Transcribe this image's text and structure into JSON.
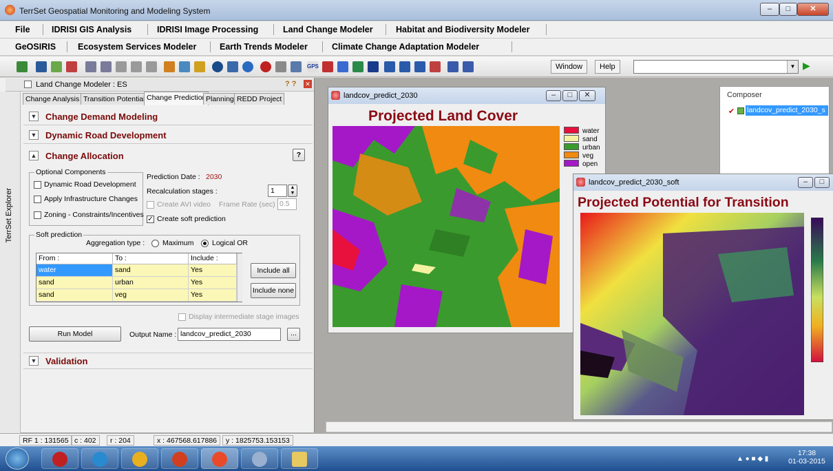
{
  "window": {
    "title": "TerrSet Geospatial Monitoring and Modeling System",
    "min": "–",
    "max": "□",
    "close": "✕"
  },
  "menu1": [
    "File",
    "IDRISI GIS Analysis",
    "IDRISI Image Processing",
    "Land Change Modeler",
    "Habitat and Biodiversity Modeler"
  ],
  "menu2": [
    "GeOSIRIS",
    "Ecosystem Services Modeler",
    "Earth Trends Modeler",
    "Climate Change Adaptation Modeler"
  ],
  "toolbar": {
    "window": "Window",
    "help": "Help",
    "gps": "GPS",
    "run": "▶"
  },
  "explorer": {
    "label": "TerrSet Explorer",
    "expand": "+"
  },
  "lcm": {
    "title": "Land Change Modeler : ES",
    "help_icons": "? ?",
    "tabs": [
      "Change Analysis",
      "Transition Potentials",
      "Change Prediction",
      "Planning",
      "REDD Project"
    ],
    "sections": {
      "demand": "Change Demand Modeling",
      "road": "Dynamic Road Development",
      "allocation": "Change Allocation",
      "validation": "Validation"
    },
    "help_btn": "?",
    "optional_components": "Optional Components",
    "opt": [
      "Dynamic Road Development",
      "Apply Infrastructure Changes",
      "Zoning - Constraints/Incentives"
    ],
    "prediction_date_label": "Prediction Date :",
    "prediction_date": "2030",
    "recalc_label": "Recalculation stages :",
    "recalc_value": "1",
    "avi_label": "Create AVI video",
    "frame_rate_label": "Frame Rate (sec) :",
    "frame_rate": "0.5",
    "soft_label": "Create soft prediction",
    "soft_prediction": "Soft prediction",
    "aggregation_label": "Aggregation type :",
    "agg_max": "Maximum",
    "agg_or": "Logical OR",
    "grid_headers": [
      "From :",
      "To :",
      "Include :"
    ],
    "grid_rows": [
      [
        "water",
        "sand",
        "Yes"
      ],
      [
        "sand",
        "urban",
        "Yes"
      ],
      [
        "sand",
        "veg",
        "Yes"
      ]
    ],
    "include_all": "Include all",
    "include_none": "Include none",
    "display_intermediate": "Display intermediate stage images",
    "run_model": "Run Model",
    "output_label": "Output Name :",
    "output_value": "landcov_predict_2030",
    "browse": "..."
  },
  "map1": {
    "title": "landcov_predict_2030",
    "heading": "Projected Land Cover",
    "legend": [
      {
        "label": "water",
        "color": "#e8103c"
      },
      {
        "label": "sand",
        "color": "#f4f2a0"
      },
      {
        "label": "urban",
        "color": "#3a9a2e"
      },
      {
        "label": "veg",
        "color": "#f08a10"
      },
      {
        "label": "open",
        "color": "#a418c8"
      }
    ]
  },
  "map2": {
    "title": "landcov_predict_2030_soft",
    "heading": "Projected Potential for Transition"
  },
  "composer": {
    "title": "Composer",
    "layer": "landcov_predict_2030_s"
  },
  "status": {
    "rf": "RF 1 : 131565",
    "c": "c : 402",
    "r": "r : 204",
    "x": "x : 467568.617886",
    "y": "y : 1825753.153153"
  },
  "clock": {
    "time": "17:38",
    "date": "01-03-2015"
  }
}
